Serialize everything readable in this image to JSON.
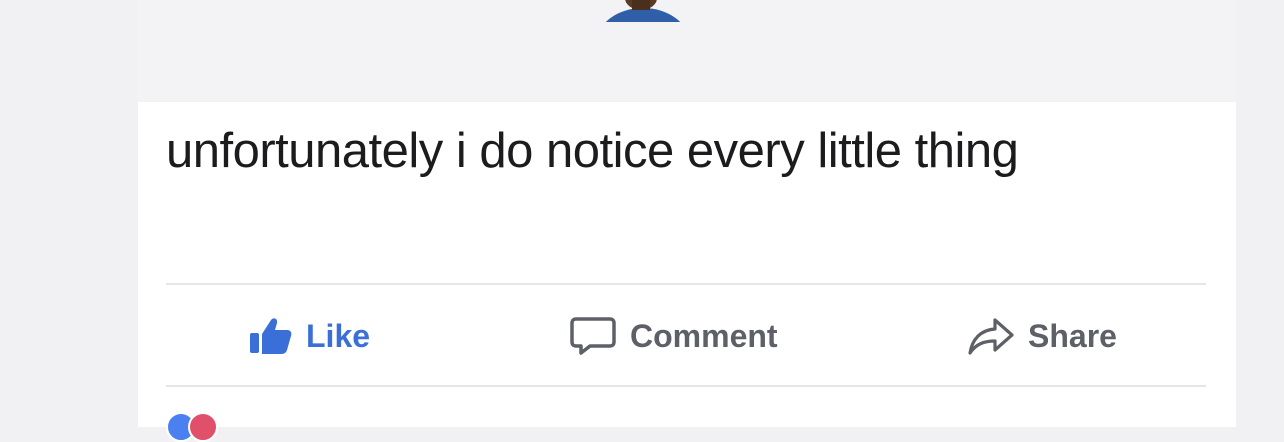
{
  "post": {
    "text": "unfortunately i do notice every little thing"
  },
  "actions": {
    "like_label": "Like",
    "comment_label": "Comment",
    "share_label": "Share"
  },
  "icons": {
    "like": "thumbs-up-icon",
    "comment": "speech-bubble-icon",
    "share": "share-arrow-icon"
  },
  "colors": {
    "like_accent": "#3b6fd8",
    "action_gray": "#5d6066",
    "text": "#1c1c1e"
  }
}
